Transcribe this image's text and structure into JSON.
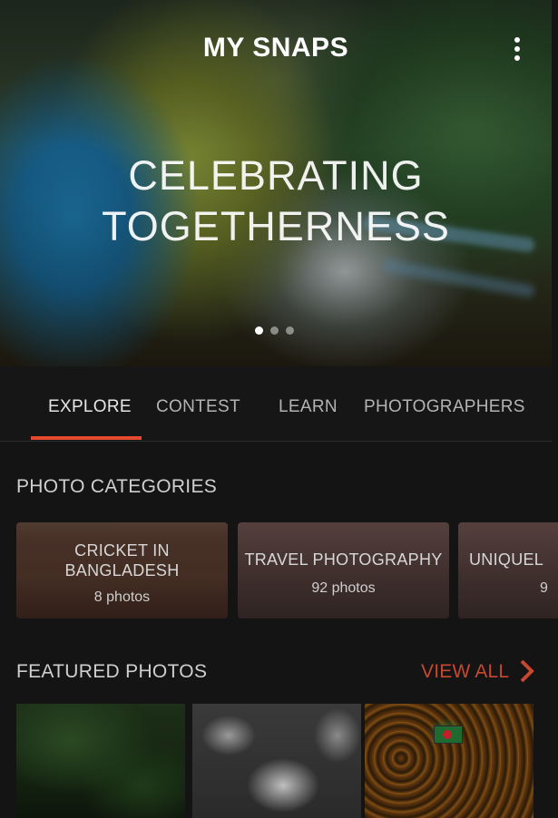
{
  "header": {
    "app_title": "MY SNAPS",
    "headline_line1": "CELEBRATING",
    "headline_line2": "TOGETHERNESS",
    "carousel_pages": 3,
    "carousel_active": 1
  },
  "tabs": [
    {
      "label": "EXPLORE",
      "active": true
    },
    {
      "label": "CONTEST",
      "active": false
    },
    {
      "label": "LEARN",
      "active": false
    },
    {
      "label": "PHOTOGRAPHERS",
      "active": false
    }
  ],
  "categories": {
    "title": "PHOTO CATEGORIES",
    "items": [
      {
        "name_line1": "CRICKET IN",
        "name_line2": "BANGLADESH",
        "count": "8 photos"
      },
      {
        "name_line1": "TRAVEL PHOTOGRAPHY",
        "count": "92 photos"
      },
      {
        "name_line1": "UNIQUEL",
        "count": "9"
      }
    ]
  },
  "featured": {
    "title": "FEATURED PHOTOS",
    "view_all": "VIEW ALL"
  },
  "colors": {
    "accent": "#e54a2f",
    "view_all": "#c8472f",
    "background": "#141414"
  },
  "icons": {
    "menu": "more-vert-icon",
    "view_all": "chevron-right-icon"
  }
}
